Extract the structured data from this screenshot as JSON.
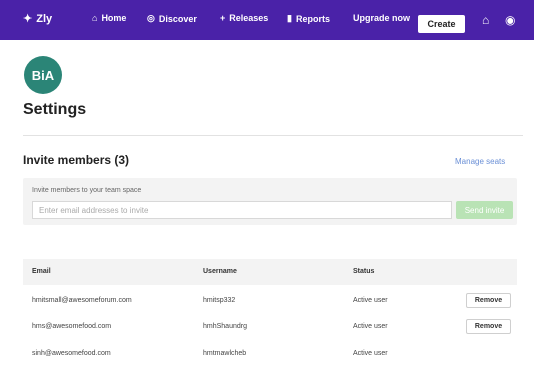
{
  "topbar": {
    "brand": "Zly",
    "nav": [
      {
        "label": "Home",
        "icon": "home-icon"
      },
      {
        "label": "Discover",
        "icon": "compass-icon"
      },
      {
        "label": "Releases",
        "icon": "plus-icon"
      },
      {
        "label": "Reports",
        "icon": "chart-icon"
      }
    ],
    "upgrade": "Upgrade now",
    "create": "Create",
    "colors": {
      "bar": "#4a22a8"
    }
  },
  "org": {
    "initials": "BiA",
    "color": "#2b8577"
  },
  "page_title": "Settings",
  "members": {
    "title": "Invite members (3)",
    "manage_link": "Manage seats",
    "invite_label": "Invite members to your team space",
    "invite_placeholder": "Enter email addresses to invite",
    "invite_button": "Send invite",
    "columns": [
      "Email",
      "Username",
      "Status"
    ],
    "rows": [
      {
        "email": "hmitsmall@awesomeforum.com",
        "username": "hmitsp332",
        "status": "Active user",
        "action": "Remove"
      },
      {
        "email": "hms@awesomefood.com",
        "username": "hmhShaundrg",
        "status": "Active user",
        "action": "Remove"
      },
      {
        "email": "sinh@awesomefood.com",
        "username": "hmtmawlcheb",
        "status": "Active user",
        "action": ""
      }
    ]
  }
}
